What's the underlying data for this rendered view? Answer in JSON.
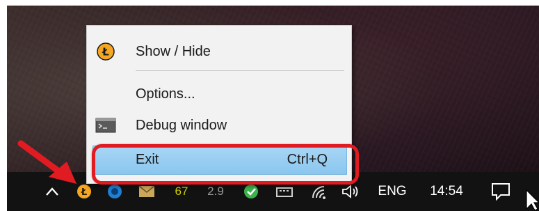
{
  "context_menu": {
    "items": [
      {
        "label": "Show / Hide",
        "icon": "litecoin-logo-icon"
      },
      {
        "label": "Options..."
      },
      {
        "label": "Debug window",
        "icon": "console-window-icon"
      },
      {
        "label": "Exit",
        "shortcut": "Ctrl+Q",
        "highlighted": true
      }
    ]
  },
  "taskbar": {
    "tray_values": [
      "67",
      "2.9"
    ],
    "language": "ENG",
    "clock": "14:54"
  },
  "colors": {
    "highlight": "#8ac6ef",
    "annotation_red": "#e11b22",
    "litecoin_orange": "#f5a623"
  }
}
